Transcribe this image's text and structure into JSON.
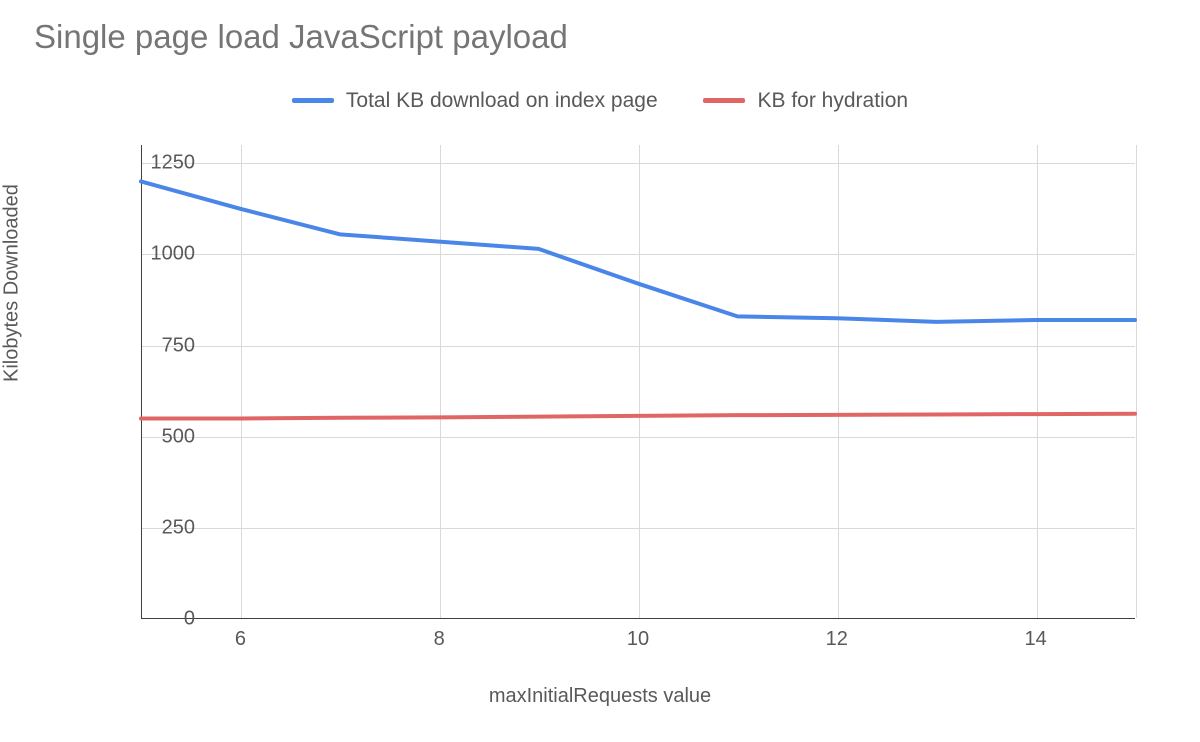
{
  "chart_data": {
    "type": "line",
    "title": "Single page load JavaScript payload",
    "xlabel": "maxInitialRequests value",
    "ylabel": "Kilobytes Downloaded",
    "x": [
      5,
      6,
      7,
      8,
      9,
      10,
      11,
      12,
      13,
      14,
      15
    ],
    "x_ticks": [
      6,
      8,
      10,
      12,
      14
    ],
    "xlim": [
      5,
      15
    ],
    "y_ticks": [
      0,
      250,
      500,
      750,
      1000,
      1250
    ],
    "ylim": [
      0,
      1300
    ],
    "series": [
      {
        "name": "Total KB download on index page",
        "color": "#4a86e8",
        "values": [
          1200,
          1125,
          1055,
          1035,
          1015,
          920,
          830,
          825,
          815,
          820,
          820
        ]
      },
      {
        "name": "KB for hydration",
        "color": "#e06666",
        "values": [
          550,
          550,
          552,
          553,
          555,
          557,
          559,
          560,
          561,
          562,
          563
        ]
      }
    ],
    "grid": true,
    "legend_position": "top"
  }
}
